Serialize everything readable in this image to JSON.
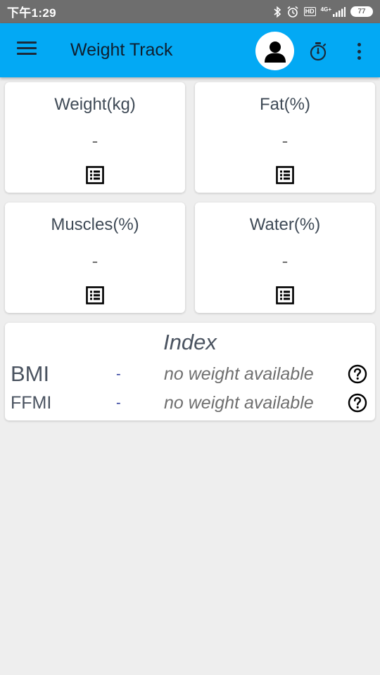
{
  "status_bar": {
    "time": "下午1:29",
    "hd": "HD",
    "network": "4G+",
    "battery": "77"
  },
  "app_bar": {
    "title": "Weight Track",
    "menu_icon": "hamburger-menu-icon",
    "profile_icon": "person-icon",
    "timer_icon": "stopwatch-icon",
    "more_icon": "more-vert-icon",
    "color": "#03a9f4"
  },
  "metrics": [
    {
      "title": "Weight(kg)",
      "value": "-",
      "icon": "list-icon"
    },
    {
      "title": "Fat(%)",
      "value": "-",
      "icon": "list-icon"
    },
    {
      "title": "Muscles(%)",
      "value": "-",
      "icon": "list-icon"
    },
    {
      "title": "Water(%)",
      "value": "-",
      "icon": "list-icon"
    }
  ],
  "index": {
    "title": "Index",
    "rows": [
      {
        "label": "BMI",
        "value": "-",
        "note": "no weight available",
        "icon": "help-circle-icon"
      },
      {
        "label": "FFMI",
        "value": "-",
        "note": "no weight available",
        "icon": "help-circle-icon"
      }
    ]
  }
}
